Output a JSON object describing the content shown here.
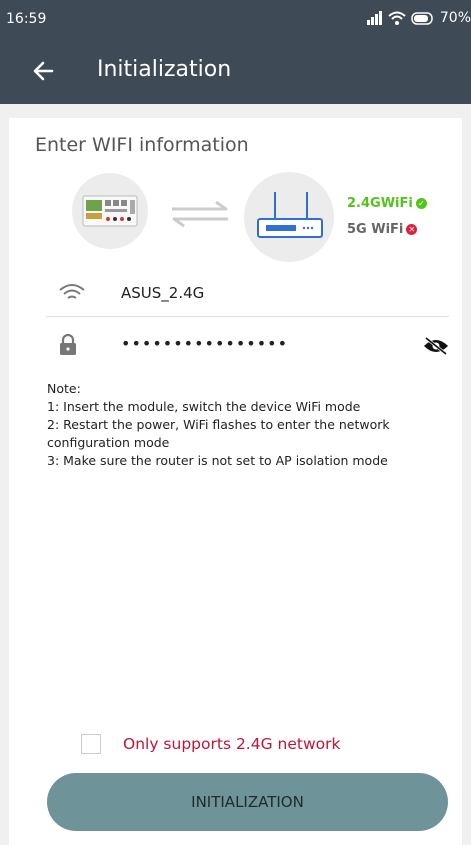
{
  "status_bar": {
    "time": "16:59",
    "battery": "70%"
  },
  "app_bar": {
    "title": "Initialization"
  },
  "section": {
    "title": "Enter WIFI information"
  },
  "bands": {
    "band_24": "2.4GWiFi",
    "band_5": "5G  WiFi",
    "band_24_ok": "✓",
    "band_5_no": "✕"
  },
  "wifi": {
    "ssid": "ASUS_2.4G",
    "password_masked": "••••••••••••••••"
  },
  "note": {
    "heading": "Note:",
    "line1": "1: Insert the module, switch the device WiFi mode",
    "line2": "2: Restart the power, WiFi flashes to enter the network configuration mode",
    "line3": "3: Make sure the router is not set to AP isolation mode"
  },
  "checkbox": {
    "label": "Only supports 2.4G network",
    "checked": false
  },
  "button": {
    "label": "INITIALIZATION"
  },
  "colors": {
    "header": "#3e4a55",
    "ok_green": "#52c41a",
    "error_red": "#e02040",
    "button": "#6e9499",
    "warning_text": "#c0143c"
  },
  "icons": [
    "signal-icon",
    "wifi-status-icon",
    "battery-icon",
    "back-arrow-icon",
    "device-icon",
    "swap-arrows-icon",
    "router-icon",
    "wifi-icon",
    "lock-icon",
    "eye-off-icon"
  ]
}
